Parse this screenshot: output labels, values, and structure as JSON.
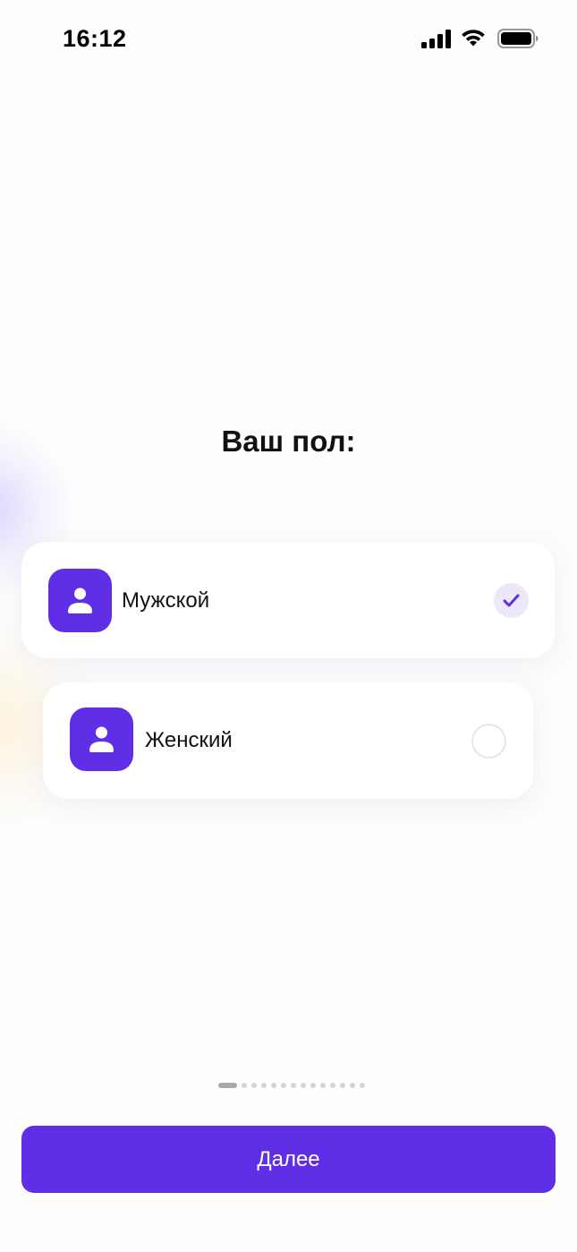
{
  "status_bar": {
    "time": "16:12",
    "icons": [
      "signal-icon",
      "wifi-icon",
      "battery-icon"
    ]
  },
  "title": "Ваш пол:",
  "options": [
    {
      "label": "Мужской",
      "icon": "person-icon",
      "selected": true
    },
    {
      "label": "Женский",
      "icon": "person-icon",
      "selected": false
    }
  ],
  "pager": {
    "total": 14,
    "current": 1
  },
  "next_button": {
    "label": "Далее"
  },
  "colors": {
    "accent": "#5f2ee6",
    "check_bg": "#ece8fa",
    "background": "#fdfdfd"
  }
}
